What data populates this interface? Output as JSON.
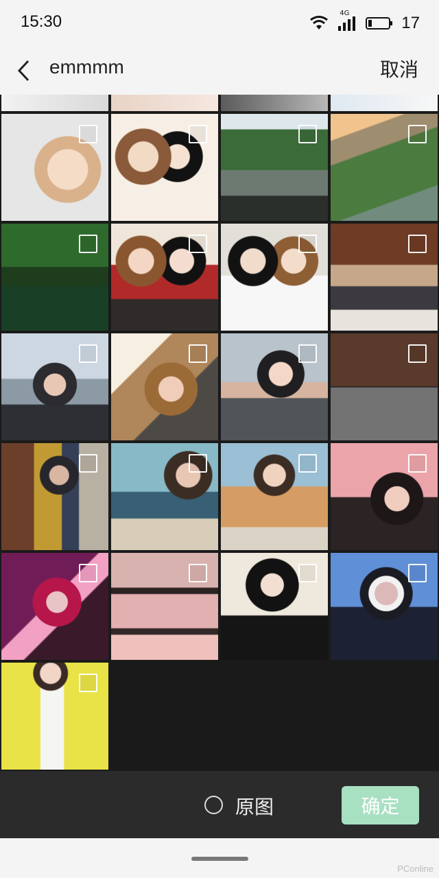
{
  "status_bar": {
    "time": "15:30",
    "network": "4G",
    "battery": "17"
  },
  "nav": {
    "title": "emmmm",
    "cancel_label": "取消"
  },
  "grid": {
    "thumbnails": [
      {
        "kind": "anime"
      },
      {
        "kind": "anime"
      },
      {
        "kind": "street"
      },
      {
        "kind": "aerial"
      },
      {
        "kind": "nature"
      },
      {
        "kind": "anime"
      },
      {
        "kind": "anime"
      },
      {
        "kind": "photo"
      },
      {
        "kind": "photo"
      },
      {
        "kind": "photo"
      },
      {
        "kind": "photo"
      },
      {
        "kind": "photo"
      },
      {
        "kind": "photo"
      },
      {
        "kind": "photo"
      },
      {
        "kind": "photo"
      },
      {
        "kind": "photo"
      },
      {
        "kind": "photo"
      },
      {
        "kind": "photo"
      },
      {
        "kind": "photo"
      },
      {
        "kind": "photo"
      },
      {
        "kind": "photo"
      }
    ]
  },
  "bottom_bar": {
    "original_label": "原图",
    "confirm_label": "确定"
  },
  "watermark": "PConline",
  "colors": {
    "confirm_bg": "#a8e0c2",
    "bottom_bar_bg": "#2b2b2b",
    "grid_bg": "#1a1a1a"
  }
}
